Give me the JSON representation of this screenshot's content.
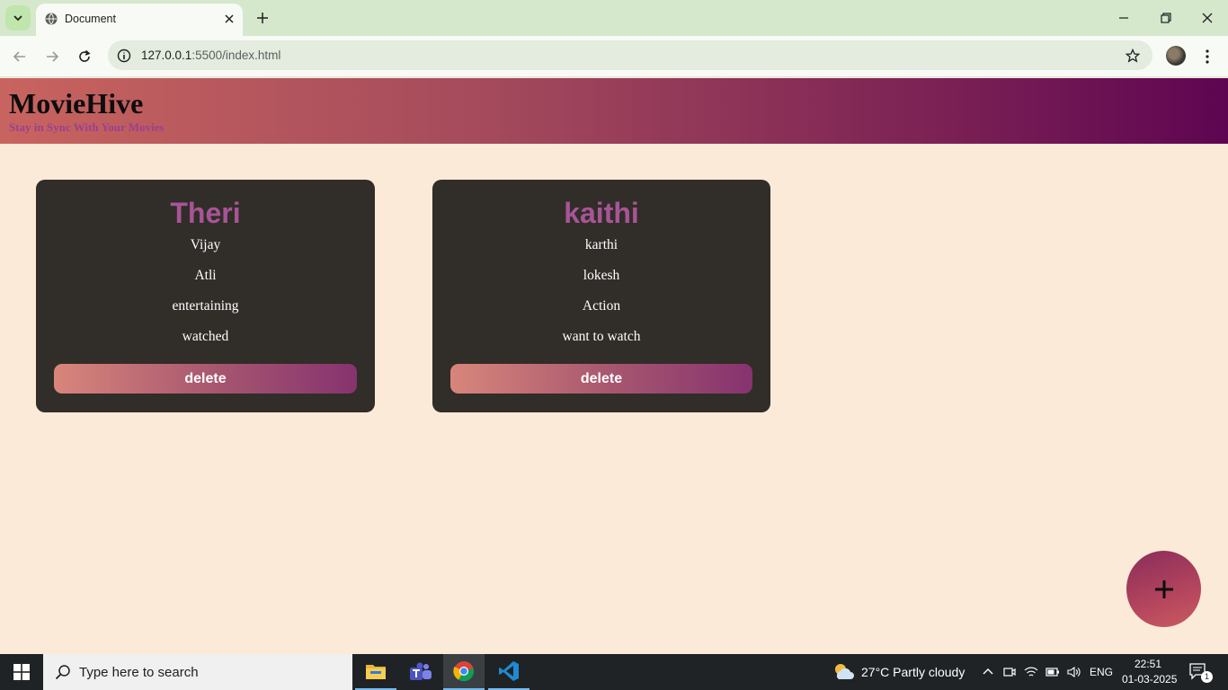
{
  "browser": {
    "tab_title": "Document",
    "url_host": "127.0.0.1",
    "url_path": ":5500/index.html"
  },
  "app": {
    "title": "MovieHive",
    "tagline": "Stay in Sync With Your Movies"
  },
  "movies": [
    {
      "title": "Theri",
      "hero": "Vijay",
      "director": "Atli",
      "genre": "entertaining",
      "status": "watched",
      "delete_label": "delete"
    },
    {
      "title": "kaithi",
      "hero": "karthi",
      "director": "lokesh",
      "genre": "Action",
      "status": "want to watch",
      "delete_label": "delete"
    }
  ],
  "fab": {
    "icon": "plus-icon"
  },
  "taskbar": {
    "search_placeholder": "Type here to search",
    "weather": "27°C  Partly cloudy",
    "language": "ENG",
    "time": "22:51",
    "date": "01-03-2025",
    "notification_count": "1"
  },
  "colors": {
    "page_bg": "#faead7",
    "card_bg": "#312d29",
    "card_title": "#a75596",
    "tagline": "#9b3f91",
    "header_gradient_start": "#c8645f",
    "header_gradient_end": "#5e0552"
  }
}
